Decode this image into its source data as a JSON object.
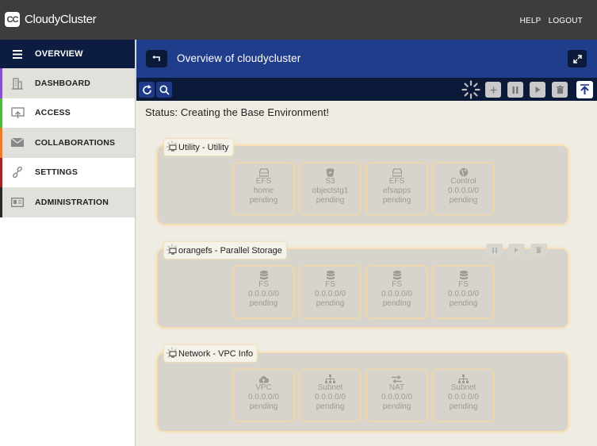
{
  "app": {
    "title": "CloudyCluster",
    "logo_text": "CC",
    "help": "HELP",
    "logout": "LOGOUT"
  },
  "sidebar": {
    "header": "OVERVIEW",
    "items": [
      {
        "label": "DASHBOARD",
        "icon": "building-icon",
        "accent": "#8a4fc9"
      },
      {
        "label": "ACCESS",
        "icon": "screen-arrow-icon",
        "accent": "#58b34b"
      },
      {
        "label": "COLLABORATIONS",
        "icon": "envelope-icon",
        "accent": "#e87c2c"
      },
      {
        "label": "SETTINGS",
        "icon": "link-icon",
        "accent": "#a32424"
      },
      {
        "label": "ADMINISTRATION",
        "icon": "id-card-icon",
        "accent": "#2a2a2a"
      }
    ]
  },
  "main": {
    "title": "Overview of cloudycluster",
    "status": "Status: Creating the Base Environment!"
  },
  "groups": [
    {
      "title": "Utility - Utility",
      "tiles": [
        {
          "icon": "drive-icon",
          "type": "EFS",
          "name": "home",
          "state": "pending"
        },
        {
          "icon": "bucket-icon",
          "type": "S3",
          "name": "objectstg1",
          "state": "pending"
        },
        {
          "icon": "drive-icon",
          "type": "EFS",
          "name": "efsapps",
          "state": "pending"
        },
        {
          "icon": "globe-icon",
          "type": "Control",
          "name": "0.0.0.0/0",
          "state": "pending"
        }
      ]
    },
    {
      "title": "orangefs - Parallel Storage",
      "tiles": [
        {
          "icon": "database-icon",
          "type": "FS",
          "name": "0.0.0.0/0",
          "state": "pending"
        },
        {
          "icon": "database-icon",
          "type": "FS",
          "name": "0.0.0.0/0",
          "state": "pending"
        },
        {
          "icon": "database-icon",
          "type": "FS",
          "name": "0.0.0.0/0",
          "state": "pending"
        },
        {
          "icon": "database-icon",
          "type": "FS",
          "name": "0.0.0.0/0",
          "state": "pending"
        }
      ]
    },
    {
      "title": "Network - VPC Info",
      "tiles": [
        {
          "icon": "cloud-upload-icon",
          "type": "VPC",
          "name": "0.0.0.0/0",
          "state": "pending"
        },
        {
          "icon": "sitemap-icon",
          "type": "Subnet",
          "name": "0.0.0.0/0",
          "state": "pending"
        },
        {
          "icon": "exchange-icon",
          "type": "NAT",
          "name": "0.0.0.0/0",
          "state": "pending"
        },
        {
          "icon": "sitemap-icon",
          "type": "Subnet",
          "name": "0.0.0.0/0",
          "state": "pending"
        }
      ]
    }
  ]
}
